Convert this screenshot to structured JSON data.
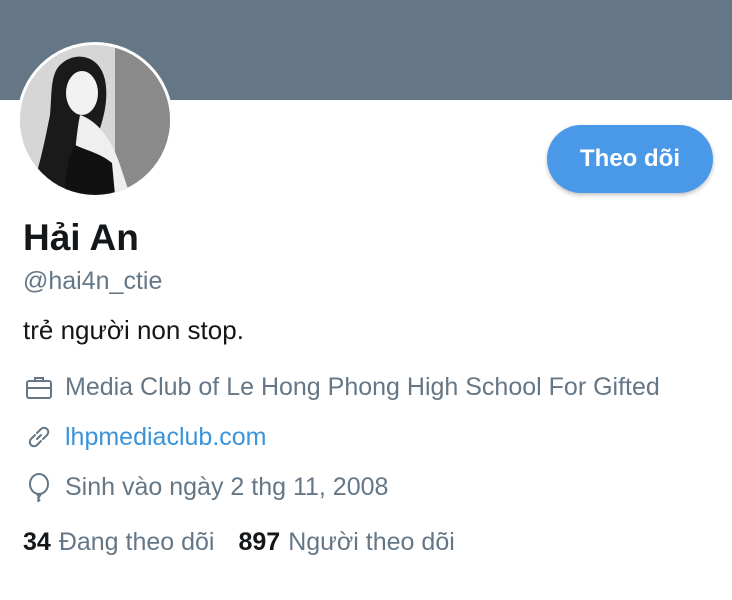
{
  "profile": {
    "name": "Hải An",
    "handle": "@hai4n_ctie",
    "bio": "trẻ người non stop.",
    "follow_label": "Theo dõi",
    "work": "Media Club of Le Hong Phong High School For Gifted",
    "website": "lhpmediaclub.com",
    "birthday": "Sinh vào ngày 2 thg 11, 2008"
  },
  "stats": {
    "following_count": "34",
    "following_label": "Đang theo dõi",
    "followers_count": "897",
    "followers_label": "Người theo dõi"
  },
  "icons": {
    "work": "briefcase-icon",
    "website": "link-icon",
    "birthday": "balloon-icon"
  },
  "colors": {
    "banner": "#657786",
    "accent": "#4a99e9",
    "link": "#3b94d9",
    "text_primary": "#14171a",
    "text_secondary": "#657786"
  }
}
